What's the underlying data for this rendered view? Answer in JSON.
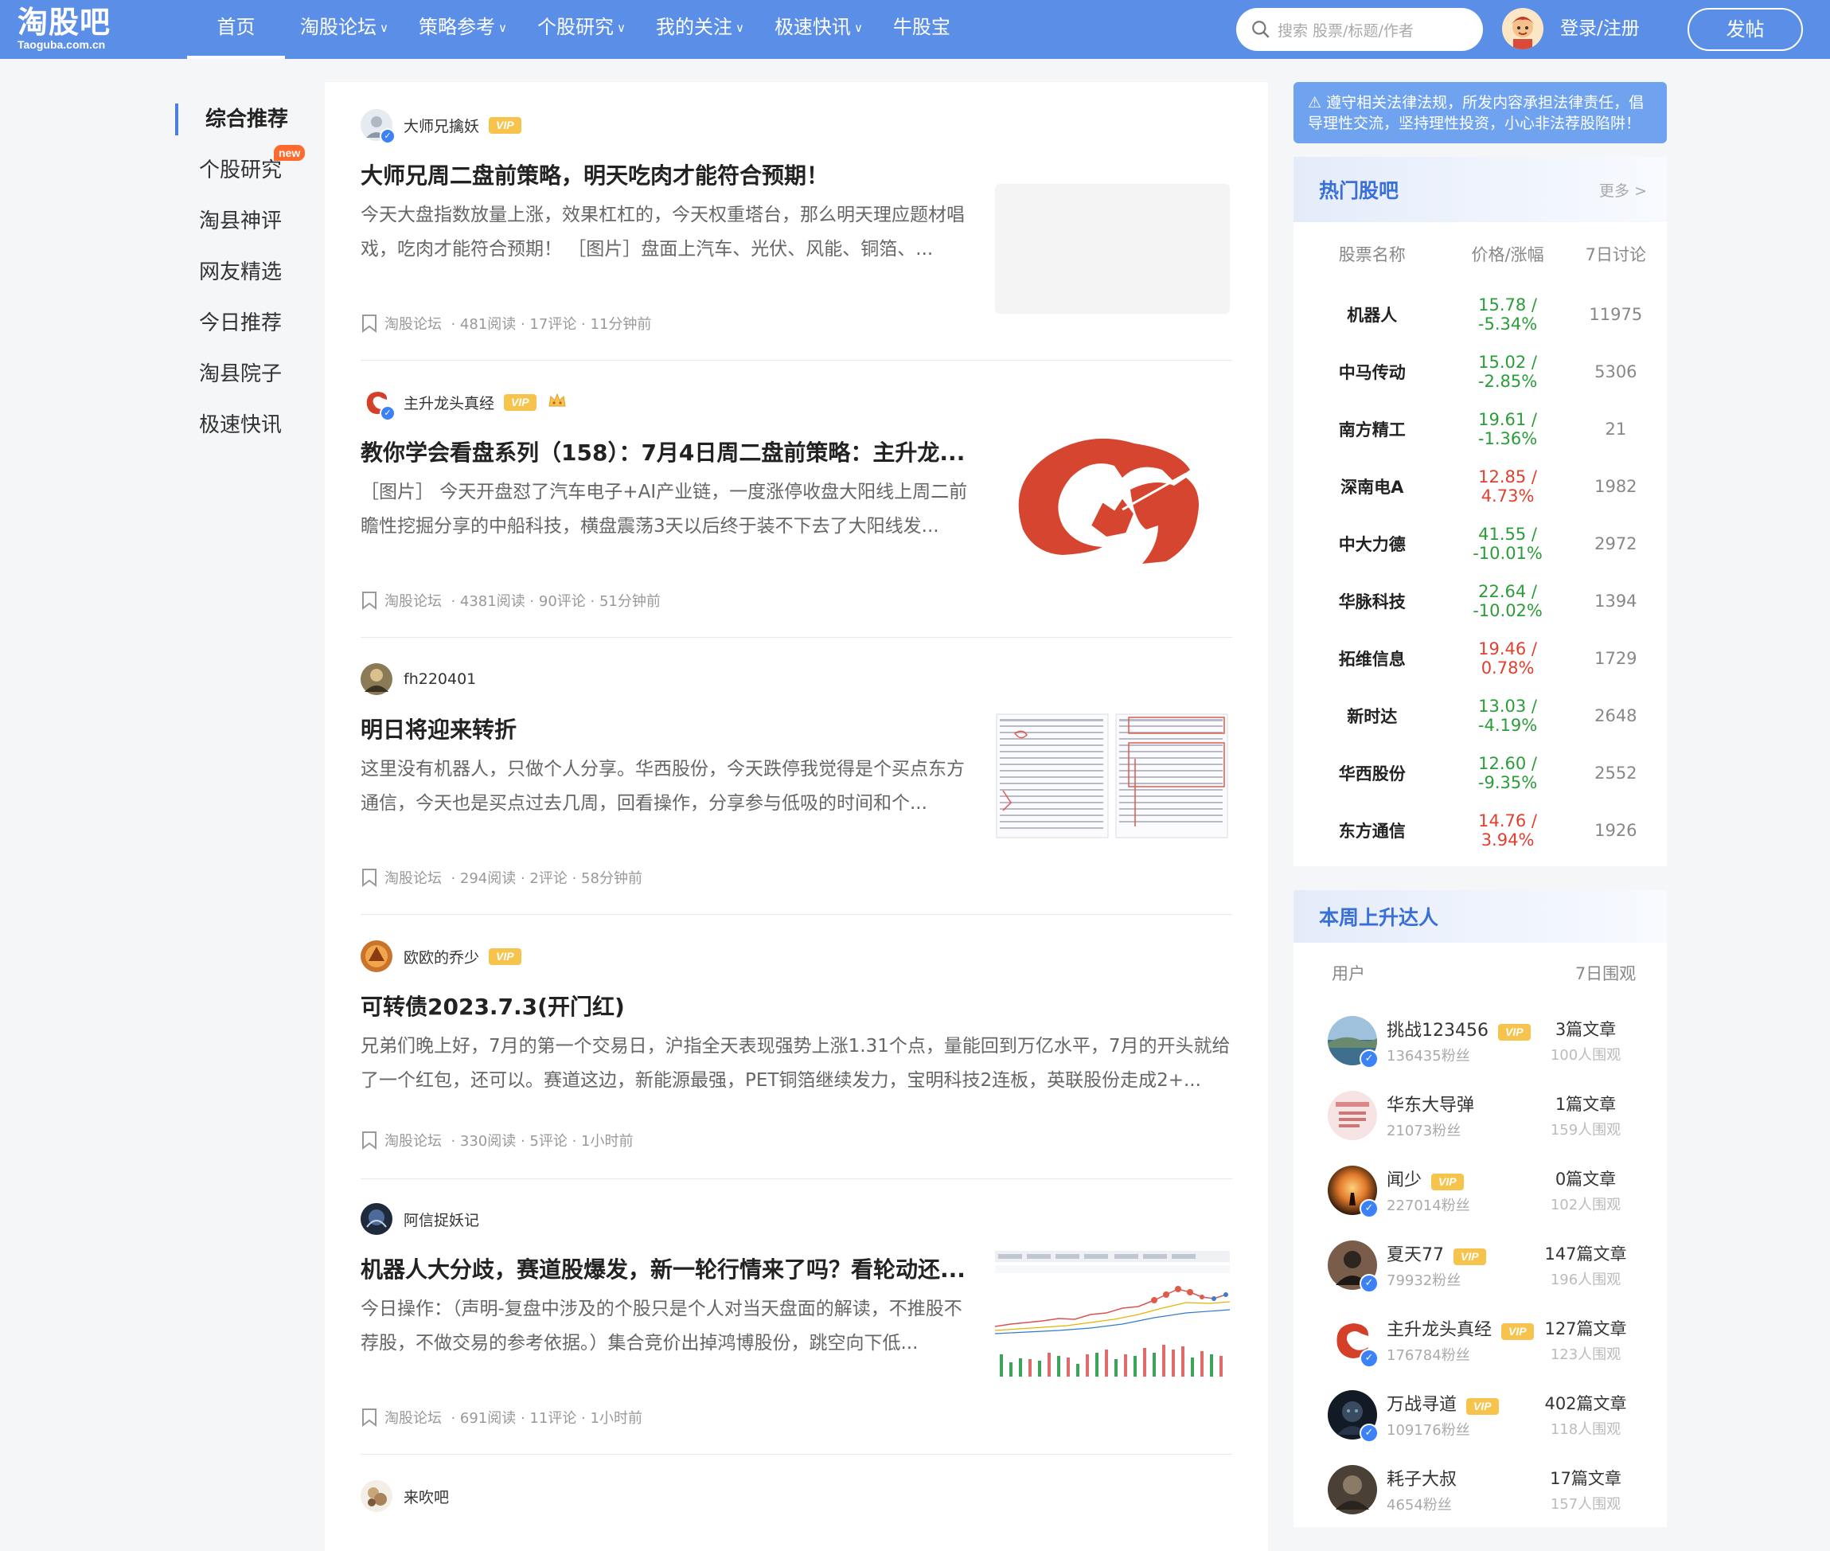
{
  "header": {
    "logo_text": "淘股吧",
    "logo_sub": "Taoguba.com.cn",
    "nav": [
      {
        "label": "首页",
        "dropdown": false
      },
      {
        "label": "淘股论坛",
        "dropdown": true
      },
      {
        "label": "策略参考",
        "dropdown": true
      },
      {
        "label": "个股研究",
        "dropdown": true
      },
      {
        "label": "我的关注",
        "dropdown": true
      },
      {
        "label": "极速快讯",
        "dropdown": true
      },
      {
        "label": "牛股宝",
        "dropdown": false
      }
    ],
    "search_placeholder": "搜索 股票/标题/作者",
    "login": "登录/注册",
    "post_button": "发帖",
    "brand_color": "#5b8fe7"
  },
  "leftnav": {
    "items": [
      "综合推荐",
      "个股研究",
      "淘县神评",
      "网友精选",
      "今日推荐",
      "淘县院子",
      "极速快讯"
    ],
    "new_badge": "new"
  },
  "posts": [
    {
      "author": "大师兄擒妖",
      "vip": "VIP",
      "title": "大师兄周二盘前策略，明天吃肉才能符合预期！",
      "body": "今天大盘指数放量上涨，效果杠杠的，今天权重塔台，那么明天理应题材唱戏，吃肉才能符合预期！ ［图片］盘面上汽车、光伏、风能、铜箔、...",
      "source": "淘股论坛",
      "stats": "· 481阅读 · 17评论 · 11分钟前"
    },
    {
      "author": "主升龙头真经",
      "vip": "VIP",
      "title": "教你学会看盘系列（158）：7月4日周二盘前策略：主升龙...",
      "body": "［图片］ 今天开盘怼了汽车电子+AI产业链，一度涨停收盘大阳线上周二前瞻性挖掘分享的中船科技，横盘震荡3天以后终于装不下去了大阳线发...",
      "source": "淘股论坛",
      "stats": "· 4381阅读 · 90评论 · 51分钟前"
    },
    {
      "author": "fh220401",
      "vip": "",
      "title": "明日将迎来转折",
      "body": "这里没有机器人，只做个人分享。华西股份，今天跌停我觉得是个买点东方通信，今天也是买点过去几周，回看操作，分享参与低吸的时间和个...",
      "source": "淘股论坛",
      "stats": "· 294阅读 · 2评论 · 58分钟前"
    },
    {
      "author": "欧欧的乔少",
      "vip": "VIP",
      "title": "可转债2023.7.3(开门红)",
      "body": "兄弟们晚上好，7月的第一个交易日，沪指全天表现强势上涨1.31个点，量能回到万亿水平，7月的开头就给了一个红包，还可以。赛道这边，新能源最强，PET铜箔继续发力，宝明科技2连板，英联股份走成2+...",
      "source": "淘股论坛",
      "stats": "· 330阅读 · 5评论 · 1小时前"
    },
    {
      "author": "阿信捉妖记",
      "vip": "",
      "title": "机器人大分歧，赛道股爆发，新一轮行情来了吗？看轮动还...",
      "body": "今日操作：（声明-复盘中涉及的个股只是个人对当天盘面的解读，不推股不荐股，不做交易的参考依据。）集合竞价出掉鸿博股份，跳空向下低...",
      "source": "淘股论坛",
      "stats": "· 691阅读 · 11评论 · 1小时前"
    },
    {
      "author": "来吹吧"
    }
  ],
  "sidebar": {
    "notice": "⚠ 遵守相关法律法规，所发内容承担法律责任，倡导理性交流，坚持理性投资，小心非法荐股陷阱！",
    "hot": {
      "title": "热门股吧",
      "more": "更多 >",
      "columns": [
        "股票名称",
        "价格/涨幅",
        "7日讨论"
      ],
      "rows": [
        {
          "name": "机器人",
          "price": "15.78 / -5.34%",
          "count": "11975",
          "up": false
        },
        {
          "name": "中马传动",
          "price": "15.02 / -2.85%",
          "count": "5306",
          "up": false
        },
        {
          "name": "南方精工",
          "price": "19.61 / -1.36%",
          "count": "21",
          "up": false
        },
        {
          "name": "深南电A",
          "price": "12.85 / 4.73%",
          "count": "1982",
          "up": true
        },
        {
          "name": "中大力德",
          "price": "41.55 / -10.01%",
          "count": "2972",
          "up": false
        },
        {
          "name": "华脉科技",
          "price": "22.64 / -10.02%",
          "count": "1394",
          "up": false
        },
        {
          "name": "拓维信息",
          "price": "19.46 / 0.78%",
          "count": "1729",
          "up": true
        },
        {
          "name": "新时达",
          "price": "13.03 / -4.19%",
          "count": "2648",
          "up": false
        },
        {
          "name": "华西股份",
          "price": "12.60 / -9.35%",
          "count": "2552",
          "up": false
        },
        {
          "name": "东方通信",
          "price": "14.76 / 3.94%",
          "count": "1926",
          "up": true
        }
      ]
    },
    "risers": {
      "title": "本周上升达人",
      "columns": [
        "用户",
        "7日围观"
      ],
      "rows": [
        {
          "name": "挑战123456",
          "vip": "VIP",
          "fans": "136435粉丝",
          "articles": "3篇文章",
          "views": "100人围观"
        },
        {
          "name": "华东大导弹",
          "vip": "",
          "fans": "21073粉丝",
          "articles": "1篇文章",
          "views": "159人围观"
        },
        {
          "name": "闻少",
          "vip": "VIP",
          "fans": "227014粉丝",
          "articles": "0篇文章",
          "views": "102人围观"
        },
        {
          "name": "夏天77",
          "vip": "VIP",
          "fans": "79932粉丝",
          "articles": "147篇文章",
          "views": "196人围观"
        },
        {
          "name": "主升龙头真经",
          "vip": "VIP",
          "fans": "176784粉丝",
          "articles": "127篇文章",
          "views": "123人围观"
        },
        {
          "name": "万战寻道",
          "vip": "VIP",
          "fans": "109176粉丝",
          "articles": "402篇文章",
          "views": "118人围观"
        },
        {
          "name": "耗子大叔",
          "vip": "",
          "fans": "4654粉丝",
          "articles": "17篇文章",
          "views": "157人围观"
        }
      ]
    }
  }
}
